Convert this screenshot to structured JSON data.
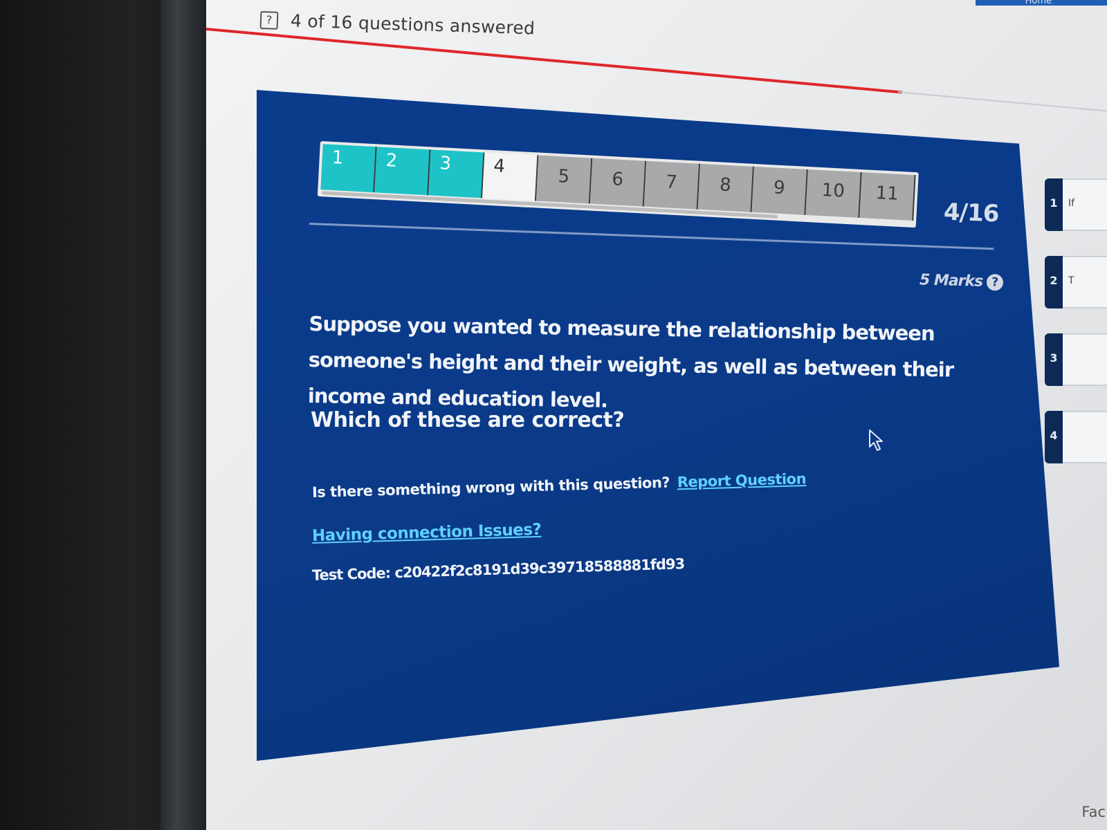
{
  "header": {
    "answered_text": "4 of 16 questions answered",
    "help_icon": "?",
    "top_right_label": "Home"
  },
  "progress": {
    "answered": 4,
    "total": 16,
    "fraction": 0.25,
    "bar_color": "#e0262b"
  },
  "navigator": {
    "items": [
      {
        "label": "1",
        "state": "done"
      },
      {
        "label": "2",
        "state": "done"
      },
      {
        "label": "3",
        "state": "done"
      },
      {
        "label": "4",
        "state": "current"
      },
      {
        "label": "5",
        "state": "todo"
      },
      {
        "label": "6",
        "state": "todo"
      },
      {
        "label": "7",
        "state": "todo"
      },
      {
        "label": "8",
        "state": "todo"
      },
      {
        "label": "9",
        "state": "todo"
      },
      {
        "label": "10",
        "state": "todo"
      },
      {
        "label": "11",
        "state": "todo"
      }
    ],
    "done_color": "#1ec3c7",
    "todo_color": "#a8a9ab"
  },
  "question": {
    "counter": "4/16",
    "marks": "5 Marks",
    "marks_help_icon": "?",
    "text": "Suppose you wanted to measure the relationship between someone's height and their weight, as well as between their income and education level.",
    "prompt": "Which of these are correct?",
    "panel_color": "#0a3a88"
  },
  "footer": {
    "report_prefix": "Is there something wrong with this question?",
    "report_link": "Report Question",
    "connection_link": "Having connection Issues?",
    "test_code": "Test Code: c20422f2c8191d39c39718588881fd93",
    "link_color": "#5fd0ff"
  },
  "side_list": {
    "items": [
      {
        "num": "1",
        "text": "If"
      },
      {
        "num": "2",
        "text": "T"
      },
      {
        "num": "3",
        "text": ""
      },
      {
        "num": "4",
        "text": ""
      }
    ],
    "bottom_label": "Fac"
  }
}
